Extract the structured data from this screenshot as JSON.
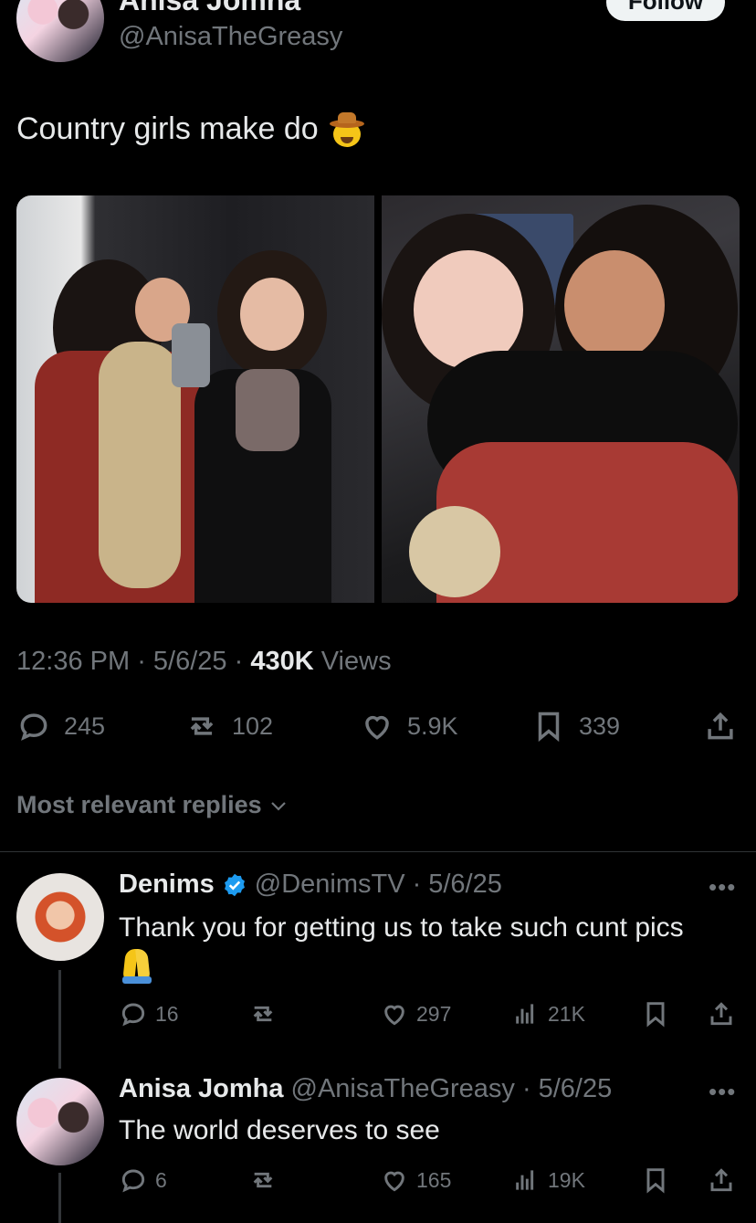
{
  "post": {
    "author_name": "Anisa Jomha",
    "author_handle": "@AnisaTheGreasy",
    "follow_label": "Follow",
    "text": "Country girls make do",
    "emoji": "cowboy-face",
    "time": "12:36 PM",
    "date": "5/6/25",
    "views_count": "430K",
    "views_label": "Views",
    "stats": {
      "replies": "245",
      "reposts": "102",
      "likes": "5.9K",
      "bookmarks": "339"
    }
  },
  "replies_sort_label": "Most relevant replies",
  "replies": [
    {
      "name": "Denims",
      "verified": true,
      "handle": "@DenimsTV",
      "date": "5/6/25",
      "text": "Thank you for getting us to take such cunt pics",
      "emoji": "folded-hands",
      "stats": {
        "replies": "16",
        "reposts": "",
        "likes": "297",
        "views": "21K"
      }
    },
    {
      "name": "Anisa Jomha",
      "verified": false,
      "handle": "@AnisaTheGreasy",
      "date": "5/6/25",
      "text": "The world deserves to see",
      "stats": {
        "replies": "6",
        "reposts": "",
        "likes": "165",
        "views": "19K"
      }
    }
  ],
  "colors": {
    "background": "#000000",
    "text_primary": "#e7e9ea",
    "text_secondary": "#71767b",
    "verified_blue": "#1d9bf0",
    "divider": "#2f3336"
  }
}
